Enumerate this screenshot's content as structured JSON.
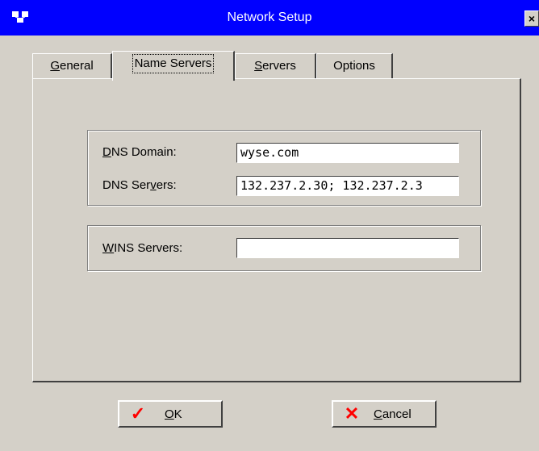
{
  "window": {
    "title": "Network Setup",
    "close_label": "×"
  },
  "tabs": [
    {
      "label_u": "G",
      "label_rest": "eneral",
      "active": false
    },
    {
      "label_u": "",
      "label_rest": "Name Servers",
      "active": true
    },
    {
      "label_u": "S",
      "label_rest": "ervers",
      "active": false
    },
    {
      "label_u": "",
      "label_rest": "Options",
      "active": false
    }
  ],
  "dns": {
    "domain_label_u": "D",
    "domain_label_rest": "NS Domain:",
    "domain_value": "wyse.com",
    "servers_label_a": "DNS Ser",
    "servers_label_u": "v",
    "servers_label_b": "ers:",
    "servers_value": "132.237.2.30; 132.237.2.3"
  },
  "wins": {
    "label_u": "W",
    "label_rest": "INS Servers:",
    "value": ""
  },
  "buttons": {
    "ok": {
      "glyph": "✓",
      "label_u": "O",
      "label_rest": "K"
    },
    "cancel": {
      "glyph": "✕",
      "label_u": "C",
      "label_rest": "ancel"
    }
  },
  "colors": {
    "titlebar": "#0000ff",
    "face": "#d4d0c8",
    "glyph": "#ff0000"
  }
}
